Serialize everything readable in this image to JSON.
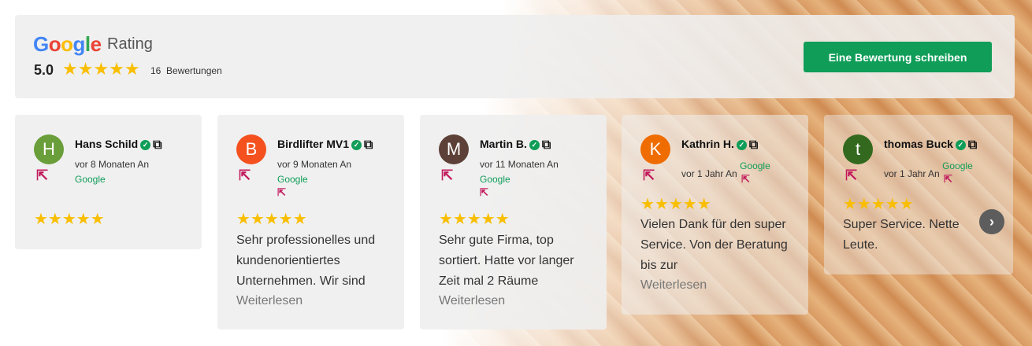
{
  "header": {
    "logo_letters": [
      "G",
      "o",
      "o",
      "g",
      "l",
      "e"
    ],
    "rating_label": "Rating",
    "score": "5.0",
    "stars": "★★★★★",
    "review_count": "16",
    "review_count_label": "Bewertungen",
    "write_button": "Eine Bewertung schreiben"
  },
  "reviews": [
    {
      "initial": "H",
      "name": "Hans Schild",
      "time": "vor 8 Monaten An",
      "source": "Google",
      "stars": "★★★★★",
      "text": "",
      "more": ""
    },
    {
      "initial": "B",
      "name": "Birdlifter MV1",
      "time": "vor 9 Monaten An",
      "source": "Google",
      "stars": "★★★★★",
      "text": "Sehr professionelles und kundenorientiertes Unternehmen. Wir sind",
      "more": "Weiterlesen"
    },
    {
      "initial": "M",
      "name": "Martin B.",
      "time": "vor 11 Monaten An",
      "source": "Google",
      "stars": "★★★★★",
      "text": "Sehr gute Firma, top sortiert. Hatte vor langer Zeit mal 2 Räume",
      "more": "Weiterlesen"
    },
    {
      "initial": "K",
      "name": "Kathrin H.",
      "time": "vor 1 Jahr An",
      "source": "Google",
      "stars": "★★★★★",
      "text": "Vielen Dank für den super Service. Von der Beratung bis zur",
      "more": "Weiterlesen"
    },
    {
      "initial": "t",
      "name": "thomas Buck",
      "time": "vor 1 Jahr An",
      "source": "Google",
      "stars": "★★★★★",
      "text": "Super Service. Nette Leute.",
      "more": ""
    }
  ],
  "colors": {
    "google_green": "#0f9d58",
    "star": "#F9BE00",
    "link_pink": "#c2185b",
    "avatar": [
      "#6a9e3a",
      "#f4511e",
      "#5d4037",
      "#ef6c00",
      "#33691e"
    ]
  },
  "icons": {
    "next": "chevron-right-icon",
    "external": "external-link-icon",
    "verified": "verified-check-icon"
  }
}
